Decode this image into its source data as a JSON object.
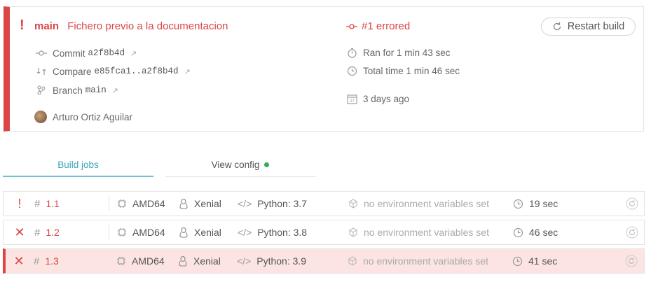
{
  "build": {
    "branch_name": "main",
    "commit_message": "Fichero previo a la documentacion",
    "state_label": "#1 errored",
    "restart_label": "Restart build",
    "commit_label": "Commit",
    "commit_sha": "a2f8b4d",
    "compare_label": "Compare",
    "compare_range": "e85fca1..a2f8b4d",
    "branch_label": "Branch",
    "branch_value": "main",
    "author": "Arturo Ortiz Aguilar",
    "ran_for": "Ran for 1 min 43 sec",
    "total_time": "Total time 1 min 46 sec",
    "finished": "3 days ago",
    "calendar_day": "27",
    "accent_color": "#db4545"
  },
  "tabs": {
    "build_jobs": "Build jobs",
    "view_config": "View config"
  },
  "jobs": [
    {
      "status": "errored",
      "status_icon": "!",
      "number": "1.1",
      "arch": "AMD64",
      "os": "Xenial",
      "language": "Python: 3.7",
      "env": "no environment variables set",
      "duration": "19 sec"
    },
    {
      "status": "failed",
      "status_icon": "✕",
      "number": "1.2",
      "arch": "AMD64",
      "os": "Xenial",
      "language": "Python: 3.8",
      "env": "no environment variables set",
      "duration": "46 sec"
    },
    {
      "status": "failed",
      "status_icon": "✕",
      "number": "1.3",
      "arch": "AMD64",
      "os": "Xenial",
      "language": "Python: 3.9",
      "env": "no environment variables set",
      "duration": "41 sec"
    }
  ]
}
